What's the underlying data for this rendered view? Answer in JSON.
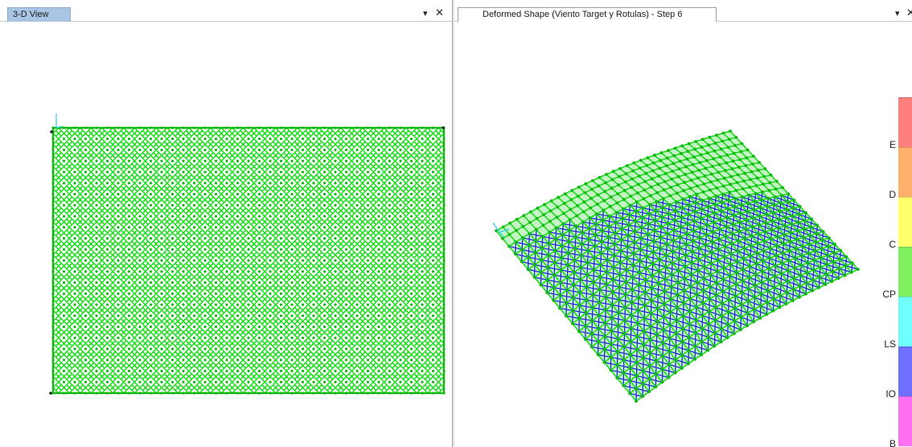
{
  "left_pane": {
    "tab_label": "3-D View",
    "pin_glyph": "▾",
    "close_glyph": "✕"
  },
  "right_pane": {
    "tab_label": "Deformed Shape (Viento Target y Rotulas) - Step 6",
    "pin_glyph": "▾",
    "close_glyph": "✕"
  },
  "colors": {
    "mesh_green": "#22dd22",
    "mesh_dark_green": "#12b812",
    "diagonal_blue": "#1a2ad8",
    "axis_cyan": "#33ccee"
  },
  "hinge_legend": {
    "bands": [
      {
        "label": "E",
        "color": "#ff7f7f"
      },
      {
        "label": "D",
        "color": "#ffb06a"
      },
      {
        "label": "C",
        "color": "#ffff6a"
      },
      {
        "label": "CP",
        "color": "#80f060"
      },
      {
        "label": "LS",
        "color": "#70ffff"
      },
      {
        "label": "IO",
        "color": "#7070ff"
      },
      {
        "label": "B",
        "color": "#ff70f0"
      }
    ]
  }
}
